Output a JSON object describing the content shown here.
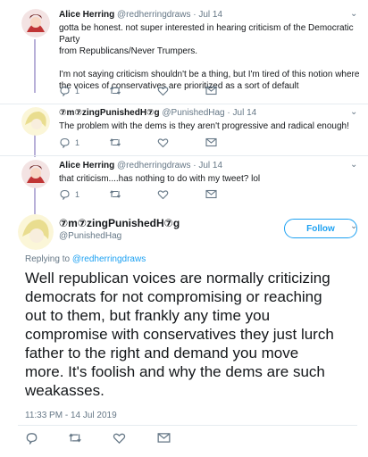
{
  "tweets": [
    {
      "name": "Alice Herring",
      "handle": "@redherringdraws",
      "dot": "·",
      "time": "Jul 14",
      "text_lines": [
        "gotta be honest. not super interested in hearing criticism of the Democratic Party",
        "from Republicans/Never Trumpers.",
        "",
        "I'm not saying criticism shouldn't be a thing, but I'm tired of this notion where",
        "the voices of conservatives are prioritized as a sort of default"
      ],
      "reply_count": "1"
    },
    {
      "name": "⑦m⑦zingPunishedH⑦g",
      "handle": "@PunishedHag",
      "dot": "·",
      "time": "Jul 14",
      "text_lines": [
        "The problem with the dems is they aren't progressive and radical enough!"
      ],
      "reply_count": "1"
    },
    {
      "name": "Alice Herring",
      "handle": "@redherringdraws",
      "dot": "·",
      "time": "Jul 14",
      "text_lines": [
        "that criticism....has nothing to do with my tweet? lol"
      ],
      "reply_count": "1"
    }
  ],
  "main": {
    "name": "⑦m⑦zingPunishedH⑦g",
    "handle": "@PunishedHag",
    "follow_label": "Follow",
    "replying_prefix": "Replying to ",
    "replying_to": "@redherringdraws",
    "text_lines": [
      "Well republican voices are normally criticizing",
      "democrats for not compromising or reaching",
      "out to them, but frankly any time you",
      "compromise with conservatives they just lurch",
      "father to the right and demand you move",
      "more. It's foolish and why the dems are such",
      "weakasses."
    ],
    "timestamp": "11:33 PM - 14 Jul 2019"
  },
  "colors": {
    "accent": "#1da1f2",
    "muted": "#657786",
    "thread": "#b8b0d8"
  },
  "icons": [
    "reply-icon",
    "retweet-icon",
    "like-icon",
    "dm-icon",
    "chevron-down-icon"
  ]
}
